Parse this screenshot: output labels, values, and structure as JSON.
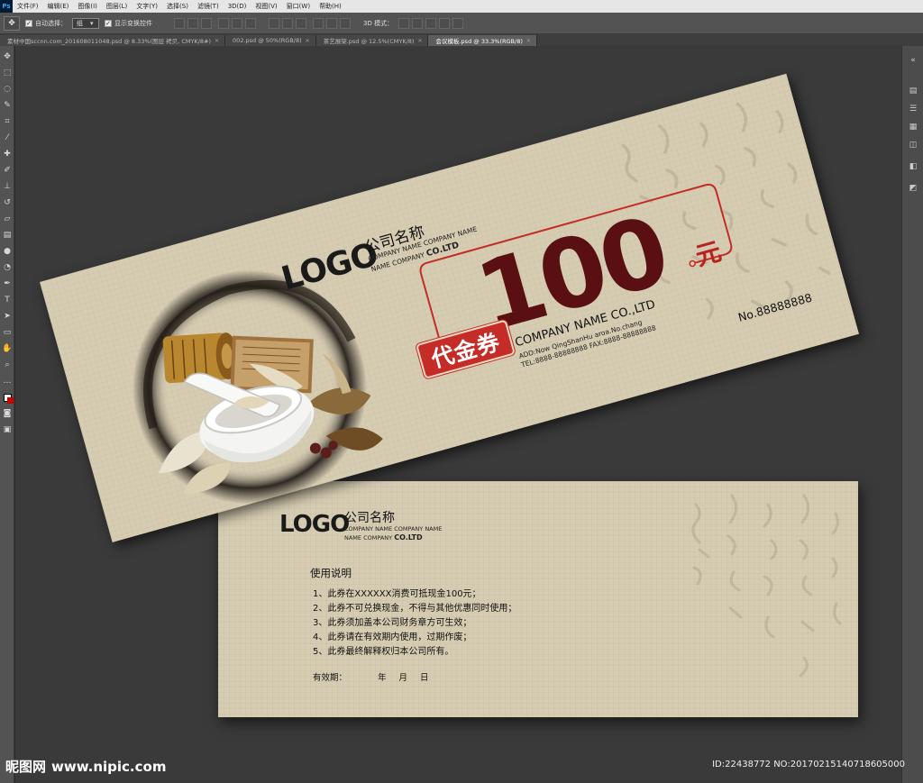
{
  "app": {
    "logo_text": "Ps",
    "menus": [
      "文件(F)",
      "编辑(E)",
      "图像(I)",
      "图层(L)",
      "文字(Y)",
      "选择(S)",
      "滤镜(T)",
      "3D(D)",
      "视图(V)",
      "窗口(W)",
      "帮助(H)"
    ]
  },
  "options": {
    "auto_select_label": "自动选择：",
    "auto_select_value": "组",
    "show_transform_label": "显示变换控件",
    "mode_3d_label": "3D 模式："
  },
  "tabs": [
    {
      "label": "素材中国sccnn.com_201608011048.psd @ 8.33%(图层 拷贝, CMYK/8#)",
      "active": false
    },
    {
      "label": "002.psd @ 50%(RGB/8)",
      "active": false
    },
    {
      "label": "茶艺展架.psd @ 12.5%(CMYK/8)",
      "active": false
    },
    {
      "label": "会议模板.psd @ 33.3%(RGB/8)",
      "active": true
    }
  ],
  "front": {
    "logo": "LOGO",
    "company_cn": "公司名称",
    "company_en_line1": "COMPANY NAME COMPANY NAME",
    "company_en_line2_prefix": "NAME COMPANY ",
    "company_en_line2_bold": "CO.LTD",
    "amount": "100",
    "currency": "元",
    "voucher_label": "代金券",
    "company_full": "COMPANY NAME CO.,LTD",
    "address": "ADD:Now QingShanHu aroa.No.chang",
    "tel_fax": "TEL:8888-88888888   FAX:8888-88888888",
    "serial": "No.88888888"
  },
  "back": {
    "logo": "LOGO",
    "company_cn": "公司名称",
    "company_en_line1": "COMPANY NAME COMPANY NAME",
    "company_en_line2_prefix": "NAME COMPANY ",
    "company_en_line2_bold": "CO.LTD",
    "usage_title": "使用说明",
    "usage_items": [
      "1、此券在XXXXXX消费可抵现金100元；",
      "2、此券不可兑换现金，不得与其他优惠同时使用；",
      "3、此券须加盖本公司财务章方可生效；",
      "4、此券请在有效期内使用，过期作废；",
      "5、此券最终解释权归本公司所有。"
    ],
    "validity_label": "有效期：",
    "year": "年",
    "month": "月",
    "day": "日"
  },
  "watermark": {
    "brand": "昵图网",
    "site": "www.nipic.com",
    "id": "ID:22438772 NO:20170215140718605000"
  },
  "colors": {
    "paper": "#d6ccb2",
    "amount": "#5a0f12",
    "accent_red": "#c52b27"
  }
}
